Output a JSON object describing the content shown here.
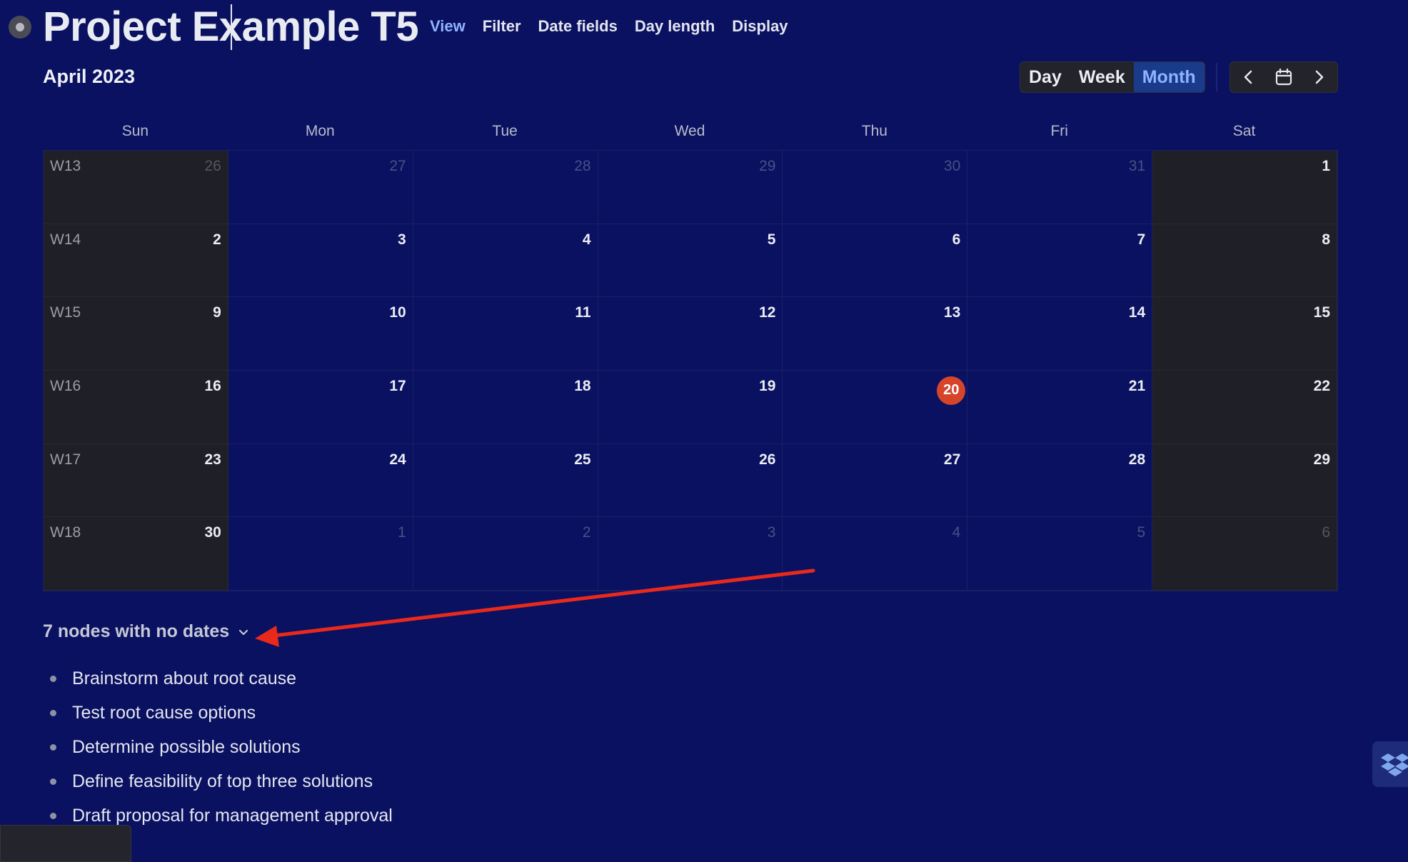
{
  "document": {
    "title": "Project Example T5"
  },
  "toolbar": {
    "view": "View",
    "filter": "Filter",
    "date_fields": "Date fields",
    "day_length": "Day length",
    "display": "Display"
  },
  "calendar": {
    "month_title": "April 2023",
    "views": {
      "day": "Day",
      "week": "Week",
      "month": "Month",
      "active": "Month"
    },
    "weekdays": [
      "Sun",
      "Mon",
      "Tue",
      "Wed",
      "Thu",
      "Fri",
      "Sat"
    ],
    "today": "20",
    "weeks": [
      {
        "label": "W13",
        "days": [
          "26",
          "27",
          "28",
          "29",
          "30",
          "31",
          "1"
        ],
        "outside": [
          true,
          true,
          true,
          true,
          true,
          true,
          false
        ]
      },
      {
        "label": "W14",
        "days": [
          "2",
          "3",
          "4",
          "5",
          "6",
          "7",
          "8"
        ],
        "outside": [
          false,
          false,
          false,
          false,
          false,
          false,
          false
        ]
      },
      {
        "label": "W15",
        "days": [
          "9",
          "10",
          "11",
          "12",
          "13",
          "14",
          "15"
        ],
        "outside": [
          false,
          false,
          false,
          false,
          false,
          false,
          false
        ]
      },
      {
        "label": "W16",
        "days": [
          "16",
          "17",
          "18",
          "19",
          "20",
          "21",
          "22"
        ],
        "outside": [
          false,
          false,
          false,
          false,
          false,
          false,
          false
        ]
      },
      {
        "label": "W17",
        "days": [
          "23",
          "24",
          "25",
          "26",
          "27",
          "28",
          "29"
        ],
        "outside": [
          false,
          false,
          false,
          false,
          false,
          false,
          false
        ]
      },
      {
        "label": "W18",
        "days": [
          "30",
          "1",
          "2",
          "3",
          "4",
          "5",
          "6"
        ],
        "outside": [
          false,
          true,
          true,
          true,
          true,
          true,
          true
        ]
      }
    ]
  },
  "no_dates": {
    "label": "7 nodes with no dates",
    "items": [
      "Brainstorm about root cause",
      "Test root cause options",
      "Determine possible solutions",
      "Define feasibility of top three solutions",
      "Draft proposal for management approval"
    ]
  },
  "icons": {
    "node_bullet": "node-bullet-icon",
    "prev": "chevron-left-icon",
    "calendar": "calendar-icon",
    "next": "chevron-right-icon",
    "expand": "chevron-down-icon",
    "dropbox": "dropbox-icon"
  },
  "colors": {
    "background": "#0a1160",
    "weekend_cell": "#1f1f27",
    "today": "#d6452a",
    "accent": "#8fb3ff",
    "annotation_arrow": "#e8291c"
  }
}
